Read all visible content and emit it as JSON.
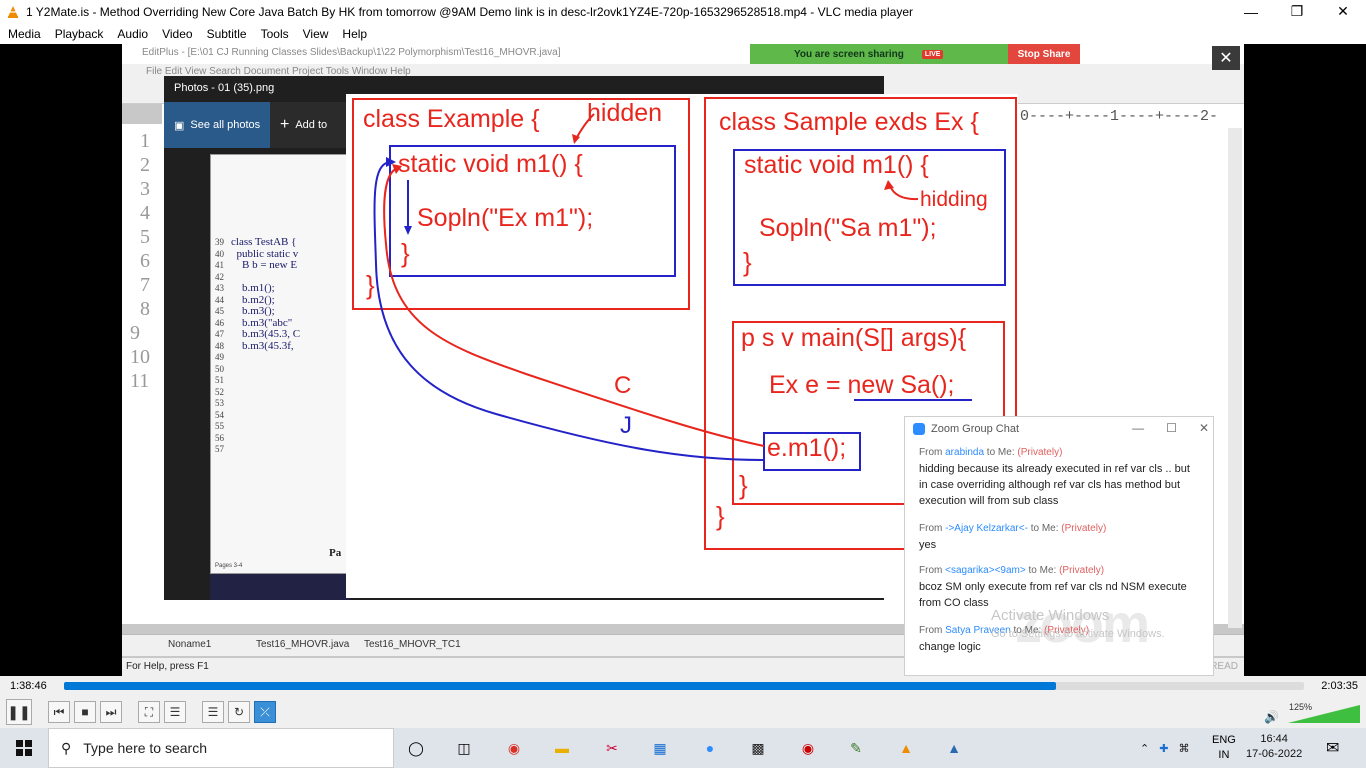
{
  "window": {
    "title": "1 Y2Mate.is - Method Overriding  New Core Java Batch By HK from tomorrow @9AM  Demo link is in desc-lr2ovk1YZ4E-720p-1653296528518.mp4 - VLC media player"
  },
  "menu": [
    "Media",
    "Playback",
    "Audio",
    "Video",
    "Subtitle",
    "Tools",
    "View",
    "Help"
  ],
  "editplus": {
    "title": "EditPlus - [E:\\01 CJ Running Classes Slides\\Backup\\1\\22 Polymorphism\\Test16_MHOVR.java]",
    "menu": "File   Edit   View   Search   Document   Project   Tools   Window   Help",
    "line_numbers": [
      "1",
      "2",
      "3",
      "4",
      "5",
      "6",
      "7",
      "8",
      "9",
      "10",
      "11"
    ],
    "ruler": "0----+----1----+----2-",
    "tabs": [
      "Noname1",
      "Test16_MHOVR.java",
      "Test16_MHOVR_TC1"
    ],
    "status": "For Help, press F1",
    "status_right": "READ"
  },
  "photos": {
    "title": "Photos - 01 (35).png",
    "see_all": "See all photos",
    "add_to": "Add to",
    "doc_line_numbers": "39\n40\n41\n42\n43\n44\n45\n46\n47\n48\n49\n50\n51\n52\n53\n54\n55\n56\n57",
    "doc_code": "class TestAB {\n  public static v\n    B b = new E\n\n    b.m1();\n    b.m2();\n    b.m3();\n    b.m3(\"abc\"\n    b.m3(45.3, C\n    b.m3(45.3f,",
    "doc_footer": "Pa",
    "doc_pages": "Pages 3-4"
  },
  "slide": {
    "example_header": "class Example {",
    "hidden_label": "hidden",
    "example_m1": "static void m1() {",
    "example_sopln": "Sopln(\"Ex m1\");",
    "brace": "}",
    "sample_header": "class Sample exds Ex {",
    "sample_m1": "static void m1() {",
    "hidding_label": "hidding",
    "sample_sopln": "Sopln(\"Sa m1\");",
    "main_header": "p s v main(S[] args){",
    "main_decl_prefix": "Ex e = ",
    "main_decl_new": "new Sa();",
    "main_call": "e.m1();",
    "label_c": "C",
    "label_j": "J"
  },
  "share_bar": {
    "text": "You are screen sharing",
    "live": "LIVE",
    "stop": "Stop Share"
  },
  "chat": {
    "title": "Zoom Group Chat",
    "messages": [
      {
        "prefix": "From ",
        "name": "arabinda",
        "to": " to Me: ",
        "priv": "(Privately)",
        "text": "hidding because its already executed in ref var cls .. but in case overriding although ref var cls has method but execution will from sub class"
      },
      {
        "prefix": "From ",
        "name": "->Ajay Kelzarkar<-",
        "to": " to Me: ",
        "priv": "(Privately)",
        "text": "yes"
      },
      {
        "prefix": "From ",
        "name": "<sagarika><9am>",
        "to": " to Me: ",
        "priv": "(Privately)",
        "text": "bcoz SM only execute  from ref var cls nd NSM execute from CO class"
      },
      {
        "prefix": "From ",
        "name": "Satya Praveen",
        "to": " to Me: ",
        "priv": "(Privately)",
        "text": "change logic"
      }
    ],
    "watermark_1": "Activate Windows",
    "watermark_2": "Go to Settings to activate Windows.",
    "logo": "zoom"
  },
  "player": {
    "elapsed": "1:38:46",
    "total": "2:03:35",
    "progress": 0.8,
    "volume": "125%"
  },
  "taskbar": {
    "search_placeholder": "Type here to search",
    "lang_1": "ENG",
    "lang_2": "IN",
    "time": "16:44",
    "date": "17-06-2022"
  }
}
